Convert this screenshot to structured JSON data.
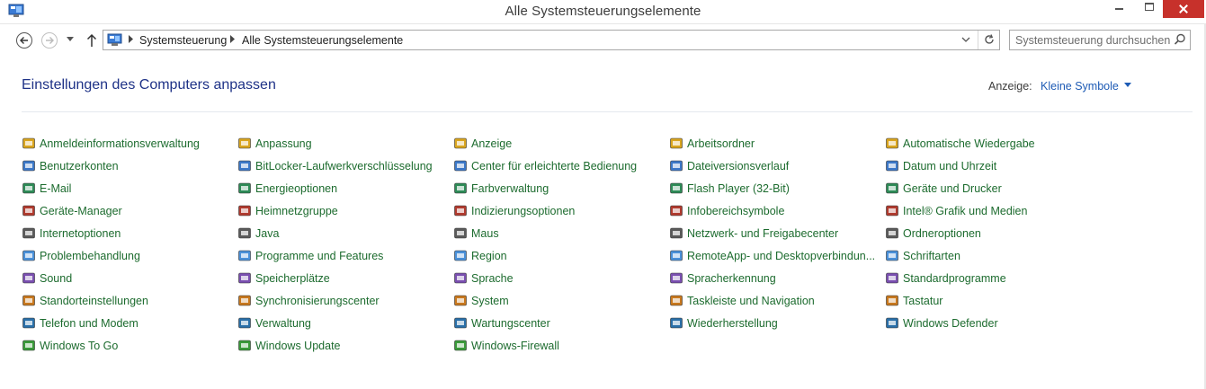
{
  "window": {
    "title": "Alle Systemsteuerungselemente"
  },
  "address": {
    "crumbs": [
      "Systemsteuerung",
      "Alle Systemsteuerungselemente"
    ]
  },
  "search": {
    "placeholder": "Systemsteuerung durchsuchen"
  },
  "header": {
    "title": "Einstellungen des Computers anpassen",
    "view_label": "Anzeige:",
    "view_value": "Kleine Symbole"
  },
  "columns": [
    [
      {
        "label": "Anmeldeinformationsverwaltung",
        "icon": "credential-vault-icon"
      },
      {
        "label": "Benutzerkonten",
        "icon": "users-icon"
      },
      {
        "label": "E-Mail",
        "icon": "mail-icon"
      },
      {
        "label": "Geräte-Manager",
        "icon": "device-manager-icon"
      },
      {
        "label": "Internetoptionen",
        "icon": "internet-options-icon"
      },
      {
        "label": "Problembehandlung",
        "icon": "troubleshooting-icon"
      },
      {
        "label": "Sound",
        "icon": "speaker-icon"
      },
      {
        "label": "Standorteinstellungen",
        "icon": "location-icon"
      },
      {
        "label": "Telefon und Modem",
        "icon": "phone-modem-icon"
      },
      {
        "label": "Windows To Go",
        "icon": "windows-to-go-icon"
      }
    ],
    [
      {
        "label": "Anpassung",
        "icon": "personalization-icon"
      },
      {
        "label": "BitLocker-Laufwerkverschlüsselung",
        "icon": "bitlocker-icon"
      },
      {
        "label": "Energieoptionen",
        "icon": "power-options-icon"
      },
      {
        "label": "Heimnetzgruppe",
        "icon": "homegroup-icon"
      },
      {
        "label": "Java",
        "icon": "java-icon"
      },
      {
        "label": "Programme und Features",
        "icon": "programs-icon"
      },
      {
        "label": "Speicherplätze",
        "icon": "storage-spaces-icon"
      },
      {
        "label": "Synchronisierungscenter",
        "icon": "sync-center-icon"
      },
      {
        "label": "Verwaltung",
        "icon": "administrative-tools-icon"
      },
      {
        "label": "Windows Update",
        "icon": "windows-update-icon"
      }
    ],
    [
      {
        "label": "Anzeige",
        "icon": "display-icon"
      },
      {
        "label": "Center für erleichterte Bedienung",
        "icon": "ease-of-access-icon"
      },
      {
        "label": "Farbverwaltung",
        "icon": "color-management-icon"
      },
      {
        "label": "Indizierungsoptionen",
        "icon": "indexing-icon"
      },
      {
        "label": "Maus",
        "icon": "mouse-icon"
      },
      {
        "label": "Region",
        "icon": "region-icon"
      },
      {
        "label": "Sprache",
        "icon": "language-icon"
      },
      {
        "label": "System",
        "icon": "system-icon"
      },
      {
        "label": "Wartungscenter",
        "icon": "action-center-flag-icon"
      },
      {
        "label": "Windows-Firewall",
        "icon": "firewall-icon"
      }
    ],
    [
      {
        "label": "Arbeitsordner",
        "icon": "work-folders-icon"
      },
      {
        "label": "Dateiversionsverlauf",
        "icon": "file-history-icon"
      },
      {
        "label": "Flash Player (32-Bit)",
        "icon": "flash-player-icon"
      },
      {
        "label": "Infobereichsymbole",
        "icon": "notification-area-icon"
      },
      {
        "label": "Netzwerk- und Freigabecenter",
        "icon": "network-center-icon"
      },
      {
        "label": "RemoteApp- und Desktopverbindun...",
        "icon": "remoteapp-icon"
      },
      {
        "label": "Spracherkennung",
        "icon": "microphone-icon"
      },
      {
        "label": "Taskleiste und Navigation",
        "icon": "taskbar-icon"
      },
      {
        "label": "Wiederherstellung",
        "icon": "recovery-icon"
      }
    ],
    [
      {
        "label": "Automatische Wiedergabe",
        "icon": "autoplay-icon"
      },
      {
        "label": "Datum und Uhrzeit",
        "icon": "date-time-icon"
      },
      {
        "label": "Geräte und Drucker",
        "icon": "printer-icon"
      },
      {
        "label": "Intel® Grafik und Medien",
        "icon": "intel-graphics-icon"
      },
      {
        "label": "Ordneroptionen",
        "icon": "folder-options-icon"
      },
      {
        "label": "Schriftarten",
        "icon": "fonts-icon"
      },
      {
        "label": "Standardprogramme",
        "icon": "default-programs-icon"
      },
      {
        "label": "Tastatur",
        "icon": "keyboard-icon"
      },
      {
        "label": "Windows Defender",
        "icon": "windows-defender-icon"
      }
    ]
  ],
  "colors": {
    "link": "#1c6b2e",
    "heading": "#1e3287",
    "accent": "#1e5bb5",
    "close": "#c7312b"
  }
}
